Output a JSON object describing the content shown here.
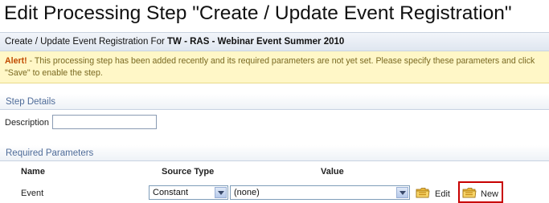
{
  "page": {
    "title": "Edit Processing Step \"Create / Update Event Registration\""
  },
  "subheader": {
    "prefix": "Create / Update Event Registration For ",
    "org": "TW",
    "sep1": " - ",
    "program": "RAS",
    "sep2": " - ",
    "event_name": "Webinar Event Summer 2010"
  },
  "alert": {
    "label": "Alert!",
    "message": " - This processing step has been added recently and its required parameters are not yet set. Please specify these parameters and click \"Save\" to enable the step."
  },
  "step_details": {
    "header": "Step Details",
    "description_label": "Description",
    "description_value": ""
  },
  "required_parameters": {
    "header": "Required Parameters",
    "columns": {
      "name": "Name",
      "source_type": "Source Type",
      "value": "Value"
    },
    "rows": [
      {
        "name": "Event",
        "source_type": "Constant",
        "value": "(none)",
        "edit_label": "Edit",
        "new_label": "New"
      }
    ]
  },
  "icons": {
    "edit": "folder-edit-icon",
    "new": "folder-new-icon"
  },
  "colors": {
    "section_header_text": "#4f6c99",
    "alert_background": "#fff7c7",
    "alert_label": "#c04a00",
    "highlight_border": "#c80000"
  }
}
